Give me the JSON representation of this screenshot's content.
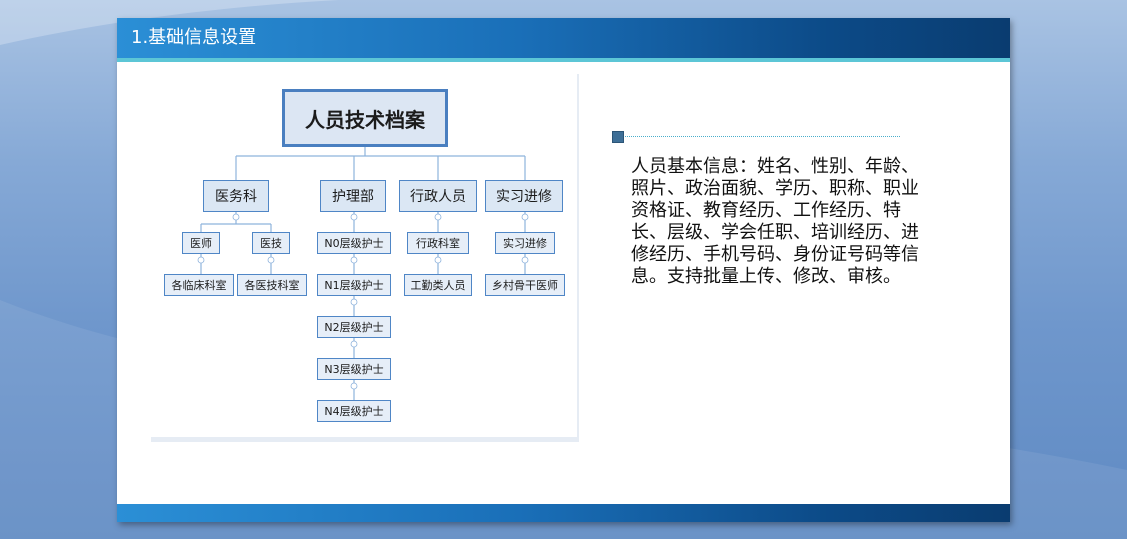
{
  "slide": {
    "title": "1.基础信息设置"
  },
  "diagram": {
    "root": "人员技术档案",
    "departments": [
      {
        "label": "医务科",
        "children": [
          "医师",
          "医技"
        ],
        "grandchildren": [
          "各临床科室",
          "各医技科室"
        ]
      },
      {
        "label": "护理部",
        "children": [
          "N0层级护士",
          "N1层级护士",
          "N2层级护士",
          "N3层级护士",
          "N4层级护士"
        ]
      },
      {
        "label": "行政人员",
        "children": [
          "行政科室",
          "工勤类人员"
        ]
      },
      {
        "label": "实习进修",
        "children": [
          "实习进修",
          "乡村骨干医师"
        ]
      }
    ]
  },
  "description": {
    "text": "人员基本信息：姓名、性别、年龄、照片、政治面貌、学历、职称、职业资格证、教育经历、工作经历、特长、层级、学会任职、培训经历、进修经历、手机号码、身份证号码等信息。支持批量上传、修改、审核。"
  },
  "colors": {
    "title_bar": "#1a6fb8",
    "accent": "#5cc6d6",
    "node_border": "#4f86c6",
    "node_fill": "#dde8f5"
  }
}
